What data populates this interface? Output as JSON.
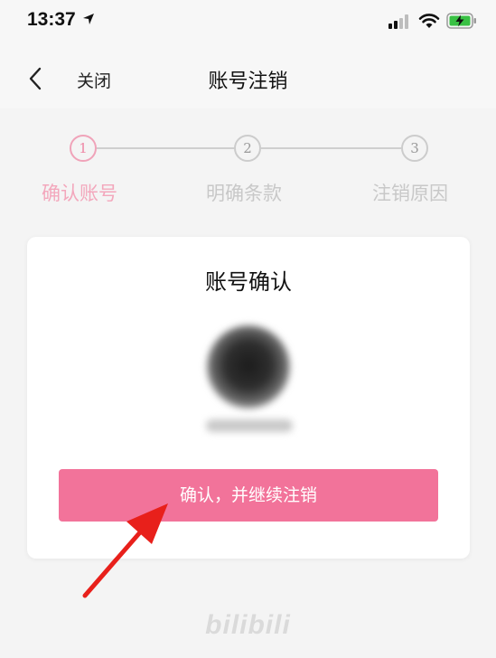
{
  "status_bar": {
    "time": "13:37"
  },
  "nav": {
    "close_label": "关闭",
    "title": "账号注销"
  },
  "steps": [
    {
      "number": "1",
      "label": "确认账号",
      "active": true
    },
    {
      "number": "2",
      "label": "明确条款",
      "active": false
    },
    {
      "number": "3",
      "label": "注销原因",
      "active": false
    }
  ],
  "card": {
    "title": "账号确认",
    "confirm_button_label": "确认，并继续注销"
  },
  "footer": {
    "logo_text": "bilibili"
  },
  "colors": {
    "accent": "#f2739a",
    "active_step": "#f3a7bc",
    "inactive_step": "#c8c8c8",
    "annotation_arrow": "#e8201b"
  }
}
